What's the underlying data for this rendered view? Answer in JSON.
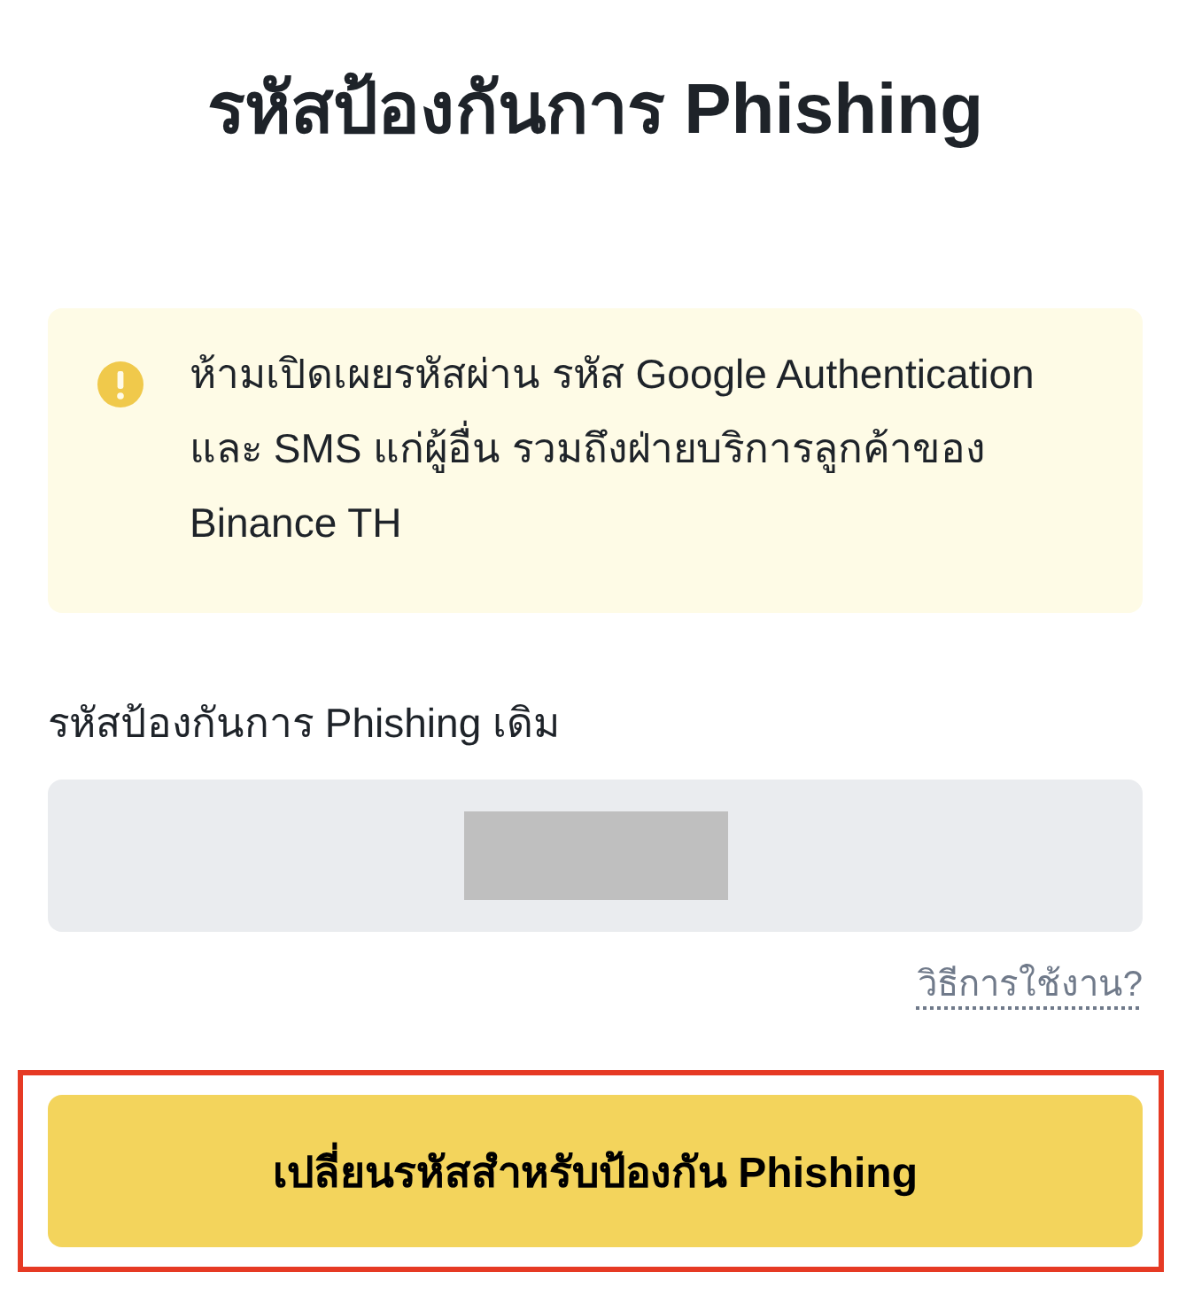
{
  "title": "รหัสป้องกันการ Phishing",
  "warning": {
    "text": "ห้ามเปิดเผยรหัสผ่าน รหัส Google Authentication และ SMS แก่ผู้อื่น รวมถึงฝ่ายบริการลูกค้าของ Binance TH"
  },
  "current_code": {
    "label": "รหัสป้องกันการ Phishing เดิม",
    "redacted": true
  },
  "help_link": "วิธีการใช้งาน?",
  "button": {
    "label": "เปลี่ยนรหัสสำหรับป้องกัน Phishing",
    "highlighted": true
  }
}
